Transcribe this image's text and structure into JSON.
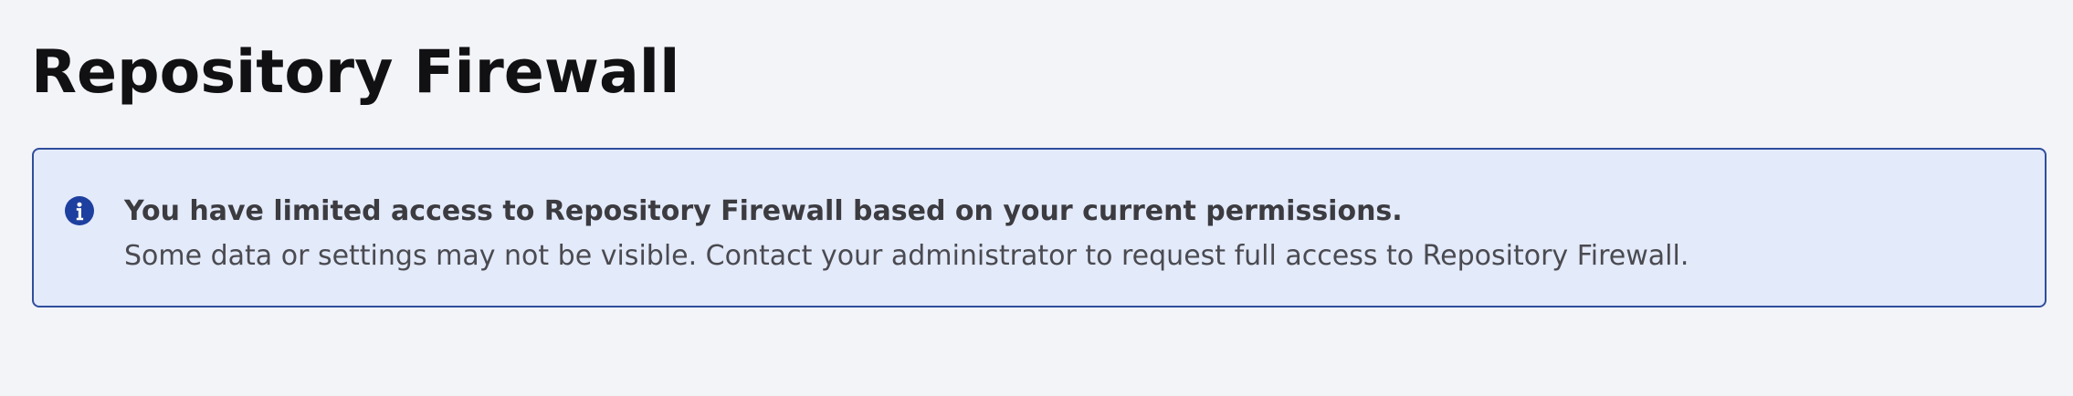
{
  "header": {
    "title": "Repository Firewall"
  },
  "alert": {
    "icon": "info-icon",
    "icon_color": "#1d3f9f",
    "background_color": "#e3eafa",
    "border_color": "#2f4e9c",
    "heading": "You have limited access to Repository Firewall based on your current permissions.",
    "message": "Some data or settings may not be visible. Contact your administrator to request full access to Repository Firewall."
  }
}
